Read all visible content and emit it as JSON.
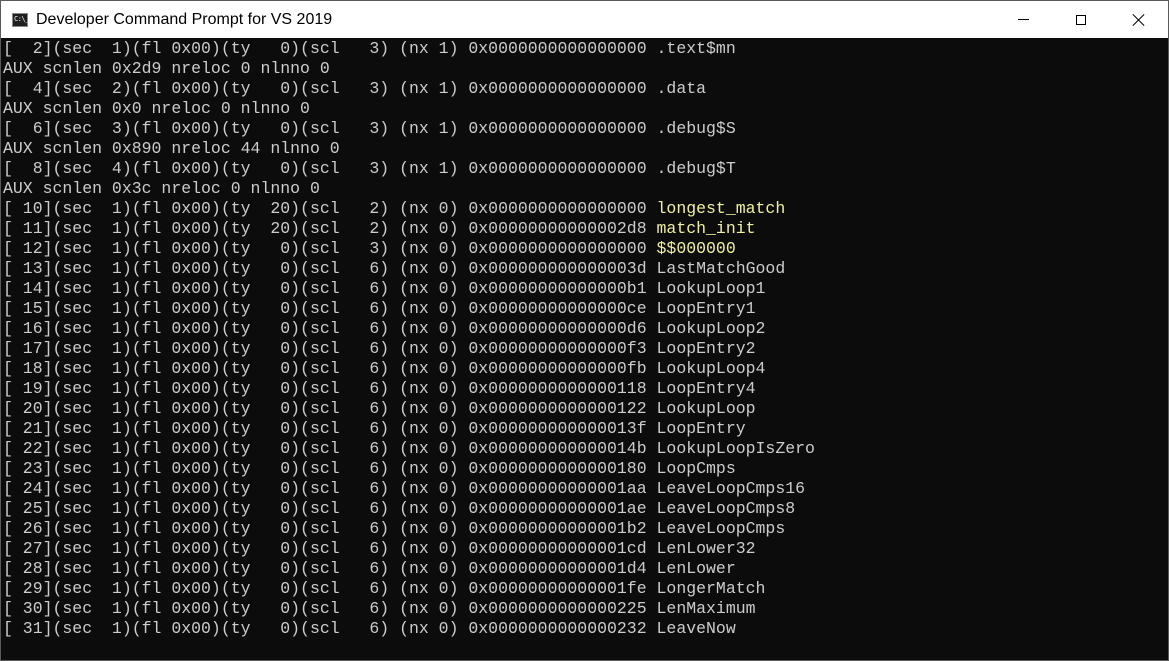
{
  "window": {
    "title": "Developer Command Prompt for VS 2019",
    "icon_text": "C:\\_"
  },
  "console": {
    "lines": [
      {
        "prefix": "[  2](sec  1)(fl 0x00)(ty   0)(scl   3) (nx 1) 0x0000000000000000 ",
        "symbol": ".text$mn",
        "highlight": false
      },
      {
        "prefix": "AUX scnlen 0x2d9 nreloc 0 nlnno 0",
        "symbol": "",
        "highlight": false
      },
      {
        "prefix": "[  4](sec  2)(fl 0x00)(ty   0)(scl   3) (nx 1) 0x0000000000000000 ",
        "symbol": ".data",
        "highlight": false
      },
      {
        "prefix": "AUX scnlen 0x0 nreloc 0 nlnno 0",
        "symbol": "",
        "highlight": false
      },
      {
        "prefix": "[  6](sec  3)(fl 0x00)(ty   0)(scl   3) (nx 1) 0x0000000000000000 ",
        "symbol": ".debug$S",
        "highlight": false
      },
      {
        "prefix": "AUX scnlen 0x890 nreloc 44 nlnno 0",
        "symbol": "",
        "highlight": false
      },
      {
        "prefix": "[  8](sec  4)(fl 0x00)(ty   0)(scl   3) (nx 1) 0x0000000000000000 ",
        "symbol": ".debug$T",
        "highlight": false
      },
      {
        "prefix": "AUX scnlen 0x3c nreloc 0 nlnno 0",
        "symbol": "",
        "highlight": false
      },
      {
        "prefix": "[ 10](sec  1)(fl 0x00)(ty  20)(scl   2) (nx 0) 0x0000000000000000 ",
        "symbol": "longest_match",
        "highlight": true
      },
      {
        "prefix": "[ 11](sec  1)(fl 0x00)(ty  20)(scl   2) (nx 0) 0x00000000000002d8 ",
        "symbol": "match_init",
        "highlight": true
      },
      {
        "prefix": "[ 12](sec  1)(fl 0x00)(ty   0)(scl   3) (nx 0) 0x0000000000000000 ",
        "symbol": "$$000000",
        "highlight": true
      },
      {
        "prefix": "[ 13](sec  1)(fl 0x00)(ty   0)(scl   6) (nx 0) 0x000000000000003d ",
        "symbol": "LastMatchGood",
        "highlight": false
      },
      {
        "prefix": "[ 14](sec  1)(fl 0x00)(ty   0)(scl   6) (nx 0) 0x00000000000000b1 ",
        "symbol": "LookupLoop1",
        "highlight": false
      },
      {
        "prefix": "[ 15](sec  1)(fl 0x00)(ty   0)(scl   6) (nx 0) 0x00000000000000ce ",
        "symbol": "LoopEntry1",
        "highlight": false
      },
      {
        "prefix": "[ 16](sec  1)(fl 0x00)(ty   0)(scl   6) (nx 0) 0x00000000000000d6 ",
        "symbol": "LookupLoop2",
        "highlight": false
      },
      {
        "prefix": "[ 17](sec  1)(fl 0x00)(ty   0)(scl   6) (nx 0) 0x00000000000000f3 ",
        "symbol": "LoopEntry2",
        "highlight": false
      },
      {
        "prefix": "[ 18](sec  1)(fl 0x00)(ty   0)(scl   6) (nx 0) 0x00000000000000fb ",
        "symbol": "LookupLoop4",
        "highlight": false
      },
      {
        "prefix": "[ 19](sec  1)(fl 0x00)(ty   0)(scl   6) (nx 0) 0x0000000000000118 ",
        "symbol": "LoopEntry4",
        "highlight": false
      },
      {
        "prefix": "[ 20](sec  1)(fl 0x00)(ty   0)(scl   6) (nx 0) 0x0000000000000122 ",
        "symbol": "LookupLoop",
        "highlight": false
      },
      {
        "prefix": "[ 21](sec  1)(fl 0x00)(ty   0)(scl   6) (nx 0) 0x000000000000013f ",
        "symbol": "LoopEntry",
        "highlight": false
      },
      {
        "prefix": "[ 22](sec  1)(fl 0x00)(ty   0)(scl   6) (nx 0) 0x000000000000014b ",
        "symbol": "LookupLoopIsZero",
        "highlight": false
      },
      {
        "prefix": "[ 23](sec  1)(fl 0x00)(ty   0)(scl   6) (nx 0) 0x0000000000000180 ",
        "symbol": "LoopCmps",
        "highlight": false
      },
      {
        "prefix": "[ 24](sec  1)(fl 0x00)(ty   0)(scl   6) (nx 0) 0x00000000000001aa ",
        "symbol": "LeaveLoopCmps16",
        "highlight": false
      },
      {
        "prefix": "[ 25](sec  1)(fl 0x00)(ty   0)(scl   6) (nx 0) 0x00000000000001ae ",
        "symbol": "LeaveLoopCmps8",
        "highlight": false
      },
      {
        "prefix": "[ 26](sec  1)(fl 0x00)(ty   0)(scl   6) (nx 0) 0x00000000000001b2 ",
        "symbol": "LeaveLoopCmps",
        "highlight": false
      },
      {
        "prefix": "[ 27](sec  1)(fl 0x00)(ty   0)(scl   6) (nx 0) 0x00000000000001cd ",
        "symbol": "LenLower32",
        "highlight": false
      },
      {
        "prefix": "[ 28](sec  1)(fl 0x00)(ty   0)(scl   6) (nx 0) 0x00000000000001d4 ",
        "symbol": "LenLower",
        "highlight": false
      },
      {
        "prefix": "[ 29](sec  1)(fl 0x00)(ty   0)(scl   6) (nx 0) 0x00000000000001fe ",
        "symbol": "LongerMatch",
        "highlight": false
      },
      {
        "prefix": "[ 30](sec  1)(fl 0x00)(ty   0)(scl   6) (nx 0) 0x0000000000000225 ",
        "symbol": "LenMaximum",
        "highlight": false
      },
      {
        "prefix": "[ 31](sec  1)(fl 0x00)(ty   0)(scl   6) (nx 0) 0x0000000000000232 ",
        "symbol": "LeaveNow",
        "highlight": false
      }
    ]
  },
  "colors": {
    "console_bg": "#0c0c0c",
    "console_text": "#cccccc",
    "highlight_text": "#f0f0a0",
    "titlebar_bg": "#ffffff"
  },
  "icons": {
    "app": "console-app-icon",
    "minimize": "minimize-icon",
    "maximize": "maximize-icon",
    "close": "close-icon"
  }
}
